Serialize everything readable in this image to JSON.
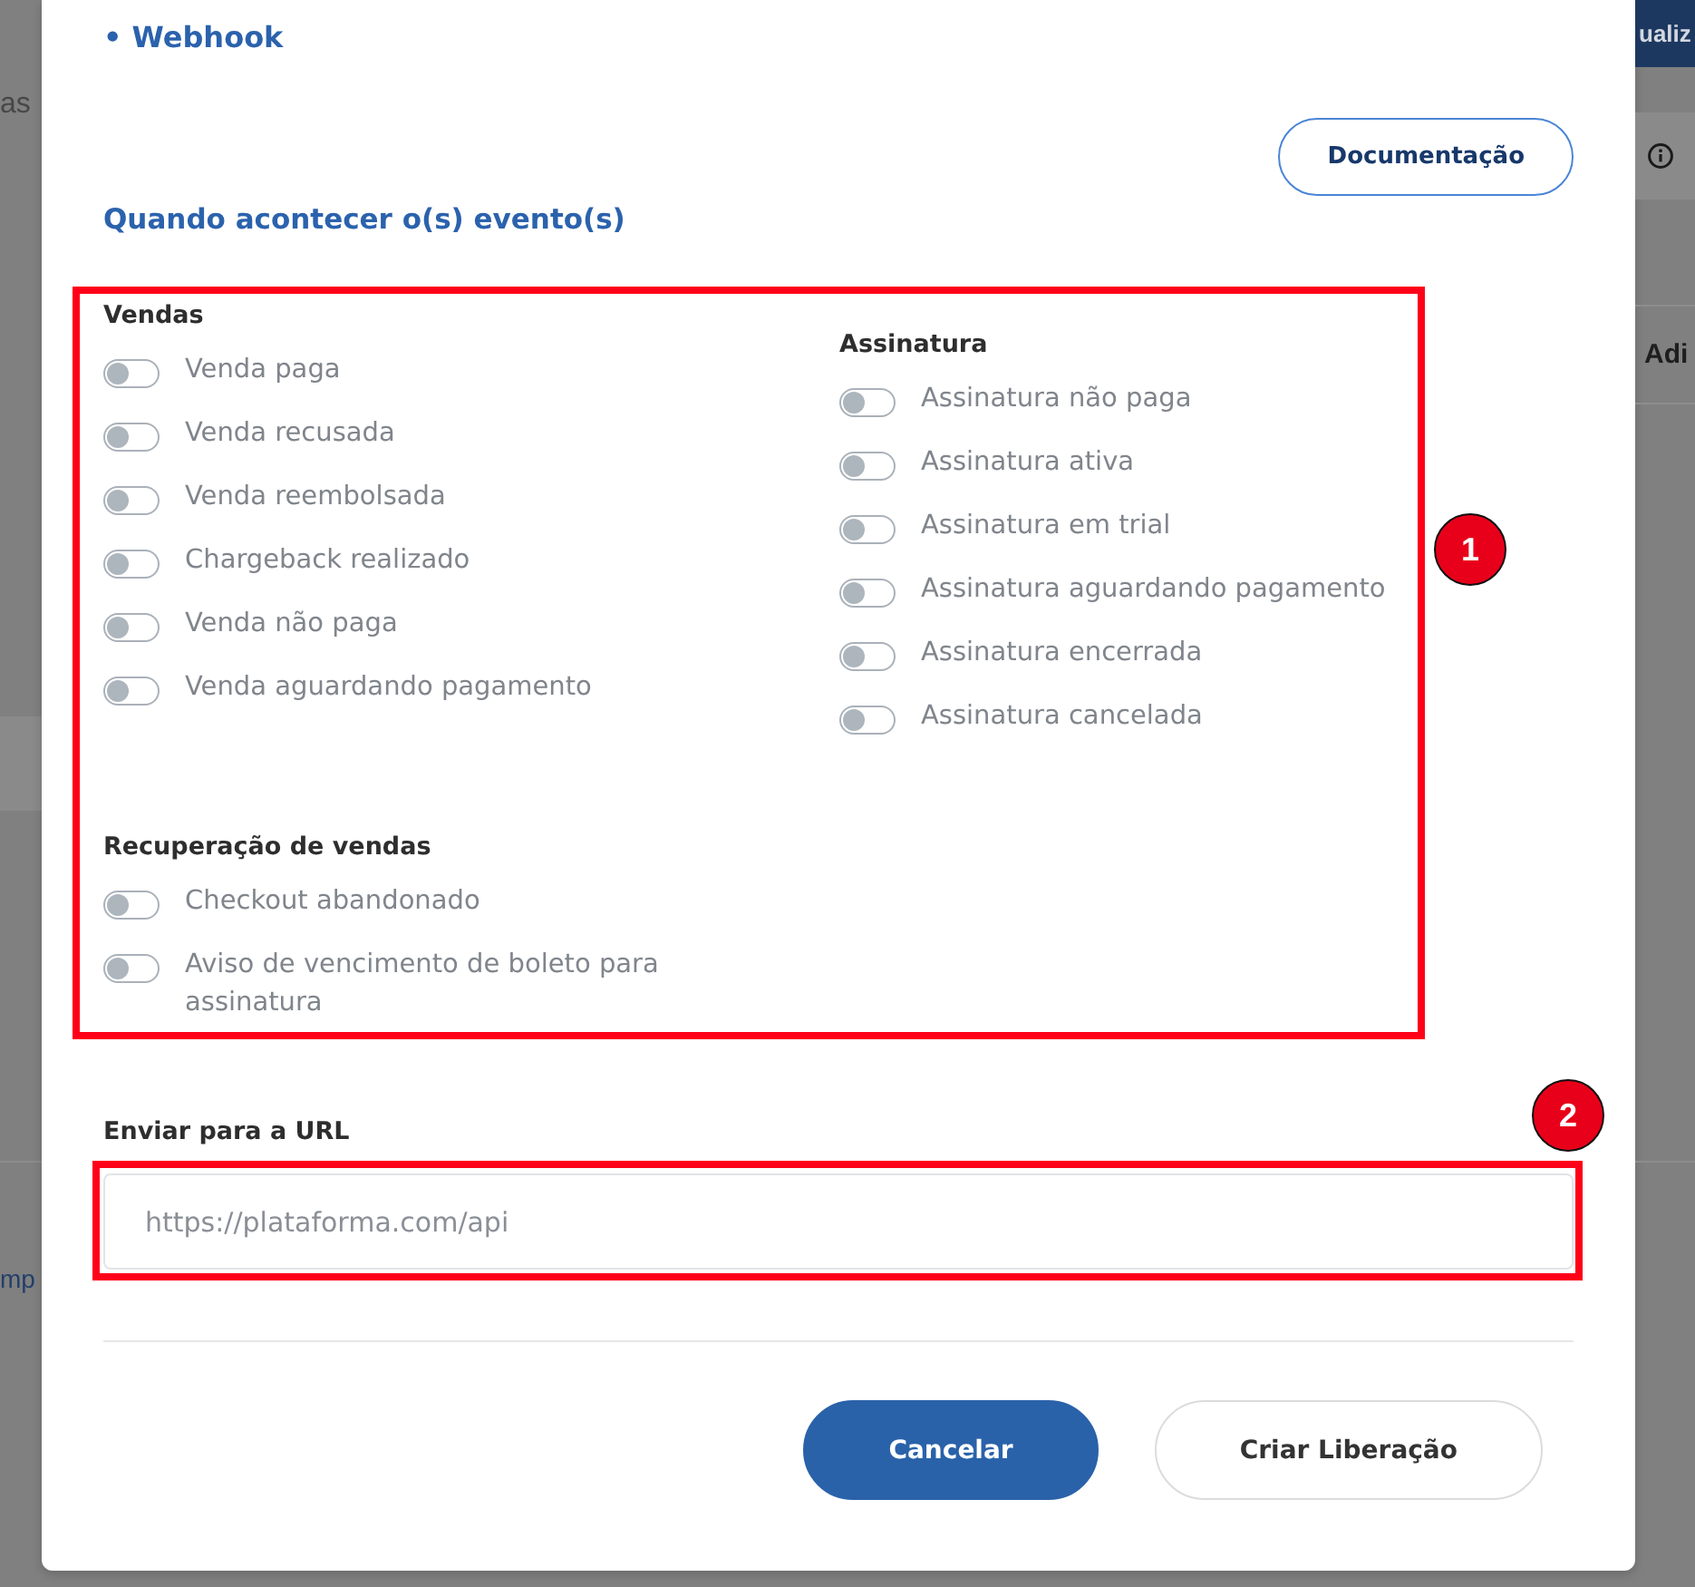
{
  "background": {
    "left_strip": {
      "text": "as",
      "link": "mp"
    },
    "right_strip": {
      "header_button": "ualiz",
      "tab": "Adi"
    }
  },
  "modal": {
    "title": "• Webhook",
    "doc_button": "Documentação",
    "section_title": "Quando acontecer o(s) evento(s)",
    "event_groups": [
      {
        "title": "Vendas",
        "events": [
          {
            "label": "Venda paga",
            "on": false
          },
          {
            "label": "Venda recusada",
            "on": false
          },
          {
            "label": "Venda reembolsada",
            "on": false
          },
          {
            "label": "Chargeback realizado",
            "on": false
          },
          {
            "label": "Venda não paga",
            "on": false
          },
          {
            "label": "Venda aguardando pagamento",
            "on": false
          }
        ]
      },
      {
        "title": "Assinatura",
        "events": [
          {
            "label": "Assinatura não paga",
            "on": false
          },
          {
            "label": "Assinatura ativa",
            "on": false
          },
          {
            "label": "Assinatura em trial",
            "on": false
          },
          {
            "label": "Assinatura aguardando pagamento",
            "on": false
          },
          {
            "label": "Assinatura encerrada",
            "on": false
          },
          {
            "label": "Assinatura cancelada",
            "on": false
          }
        ]
      },
      {
        "title": "Recuperação de vendas",
        "events": [
          {
            "label": "Checkout abandonado",
            "on": false
          },
          {
            "label": "Aviso de vencimento de boleto para assinatura",
            "on": false
          }
        ]
      }
    ],
    "url_field": {
      "label": "Enviar para a URL",
      "placeholder": "https://plataforma.com/api"
    },
    "buttons": [
      {
        "label": "Cancelar",
        "kind": "primary"
      },
      {
        "label": "Criar Liberação",
        "kind": "secondary"
      }
    ]
  },
  "annotations": [
    {
      "number": "1"
    },
    {
      "number": "2"
    }
  ]
}
